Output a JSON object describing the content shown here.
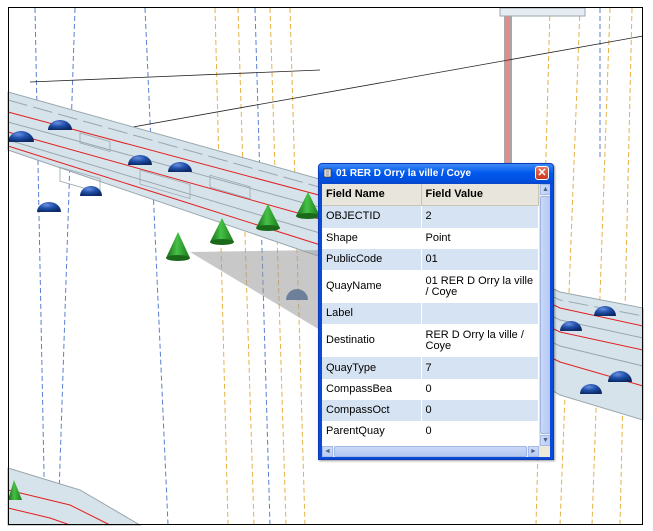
{
  "popup": {
    "title": "01 RER D Orry la ville / Coye",
    "close_glyph": "✕",
    "columns": {
      "name": "Field Name",
      "value": "Field Value"
    },
    "rows": [
      {
        "name": "OBJECTID",
        "value": "2"
      },
      {
        "name": "Shape",
        "value": "Point"
      },
      {
        "name": "PublicCode",
        "value": "01"
      },
      {
        "name": "QuayName",
        "value": "01 RER D Orry la ville / Coye"
      },
      {
        "name": "Label",
        "value": ""
      },
      {
        "name": "Destinatio",
        "value": "RER D Orry la ville / Coye"
      },
      {
        "name": "QuayType",
        "value": "7"
      },
      {
        "name": "CompassBea",
        "value": "0"
      },
      {
        "name": "CompassOct",
        "value": "0"
      },
      {
        "name": "ParentQuay",
        "value": "0"
      }
    ]
  },
  "scrollbars": {
    "up": "▲",
    "down": "▼",
    "left": "◄",
    "right": "►"
  },
  "colors": {
    "platform": "#d7e3ea",
    "platform_edge": "#9aa7ae",
    "track_red": "#e02020",
    "quay_marker": "#1f4fa8",
    "stop_cone": "#2e9e2e",
    "dashed_blue": "#5a7fd0",
    "dashed_orange": "#e6b24a",
    "popup_title": "#0058ee"
  }
}
